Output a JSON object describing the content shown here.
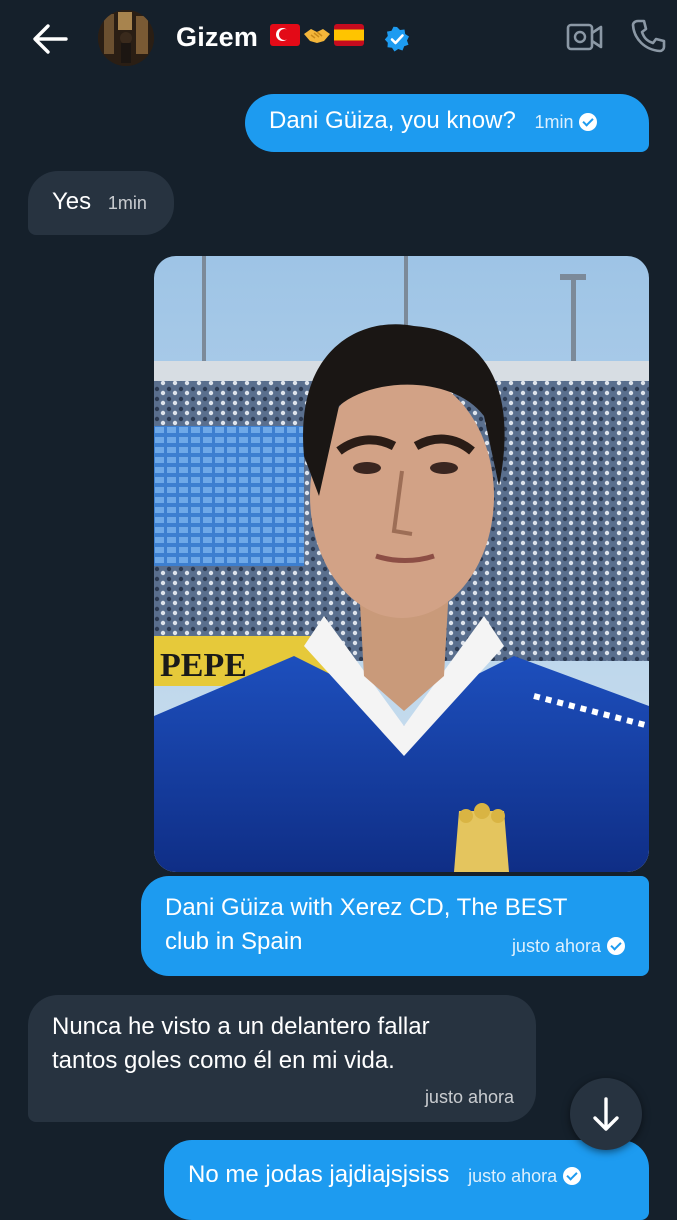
{
  "header": {
    "contact_name": "Gizem",
    "flags": [
      "turkey-flag",
      "handshake-emoji",
      "spain-flag"
    ],
    "verified": true,
    "icons": {
      "back": "arrow-left-icon",
      "video": "video-camera-icon",
      "call": "phone-icon"
    }
  },
  "messages": [
    {
      "direction": "sent",
      "text": "Dani Güiza, you know?",
      "time": "1min",
      "read": true
    },
    {
      "direction": "received",
      "text": "Yes",
      "time": "1min"
    },
    {
      "direction": "sent",
      "type": "image",
      "image_description": "football player in blue Xerez CD jersey in stadium"
    },
    {
      "direction": "sent",
      "text_line1": "Dani Güiza with Xerez CD, The BEST",
      "text_line2": "club in Spain",
      "time": "justo ahora",
      "read": true
    },
    {
      "direction": "received",
      "text_line1": "Nunca he visto a un delantero fallar",
      "text_line2": "tantos goles como él en mi vida.",
      "time": "justo ahora"
    },
    {
      "direction": "sent",
      "text": "No me jodas jajdiajsjsiss",
      "time": "justo ahora",
      "read": true
    }
  ],
  "scroll_button": {
    "icon": "arrow-down-icon"
  },
  "colors": {
    "background": "#15202b",
    "sent_bubble": "#1d9bf0",
    "received_bubble": "#273340",
    "accent": "#1d9bf0"
  }
}
